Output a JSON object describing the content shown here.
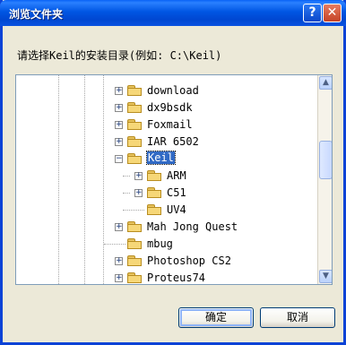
{
  "window": {
    "title": "浏览文件夹",
    "help_label": "?",
    "close_label": "✕"
  },
  "prompt": "请选择Keil的安装目录(例如: C:\\Keil)",
  "tree": {
    "items": [
      {
        "label": "download",
        "expander": "+",
        "selected": false
      },
      {
        "label": "dx9bsdk",
        "expander": "+",
        "selected": false
      },
      {
        "label": "Foxmail",
        "expander": "+",
        "selected": false
      },
      {
        "label": "IAR 6502",
        "expander": "+",
        "selected": false
      },
      {
        "label": "Keil",
        "expander": "−",
        "selected": true
      },
      {
        "label": "ARM",
        "expander": "+",
        "selected": false
      },
      {
        "label": "C51",
        "expander": "+",
        "selected": false
      },
      {
        "label": "UV4",
        "expander": "",
        "selected": false
      },
      {
        "label": "Mah Jong Quest",
        "expander": "+",
        "selected": false
      },
      {
        "label": "mbug",
        "expander": "",
        "selected": false
      },
      {
        "label": "Photoshop CS2",
        "expander": "+",
        "selected": false
      },
      {
        "label": "Proteus74",
        "expander": "+",
        "selected": false
      }
    ]
  },
  "scrollbar": {
    "up": "▲",
    "down": "▼"
  },
  "buttons": {
    "ok": "确定",
    "cancel": "取消"
  },
  "colors": {
    "titlebar": "#0058e6",
    "selection": "#316ac5",
    "dialog_bg": "#ece9d8"
  }
}
